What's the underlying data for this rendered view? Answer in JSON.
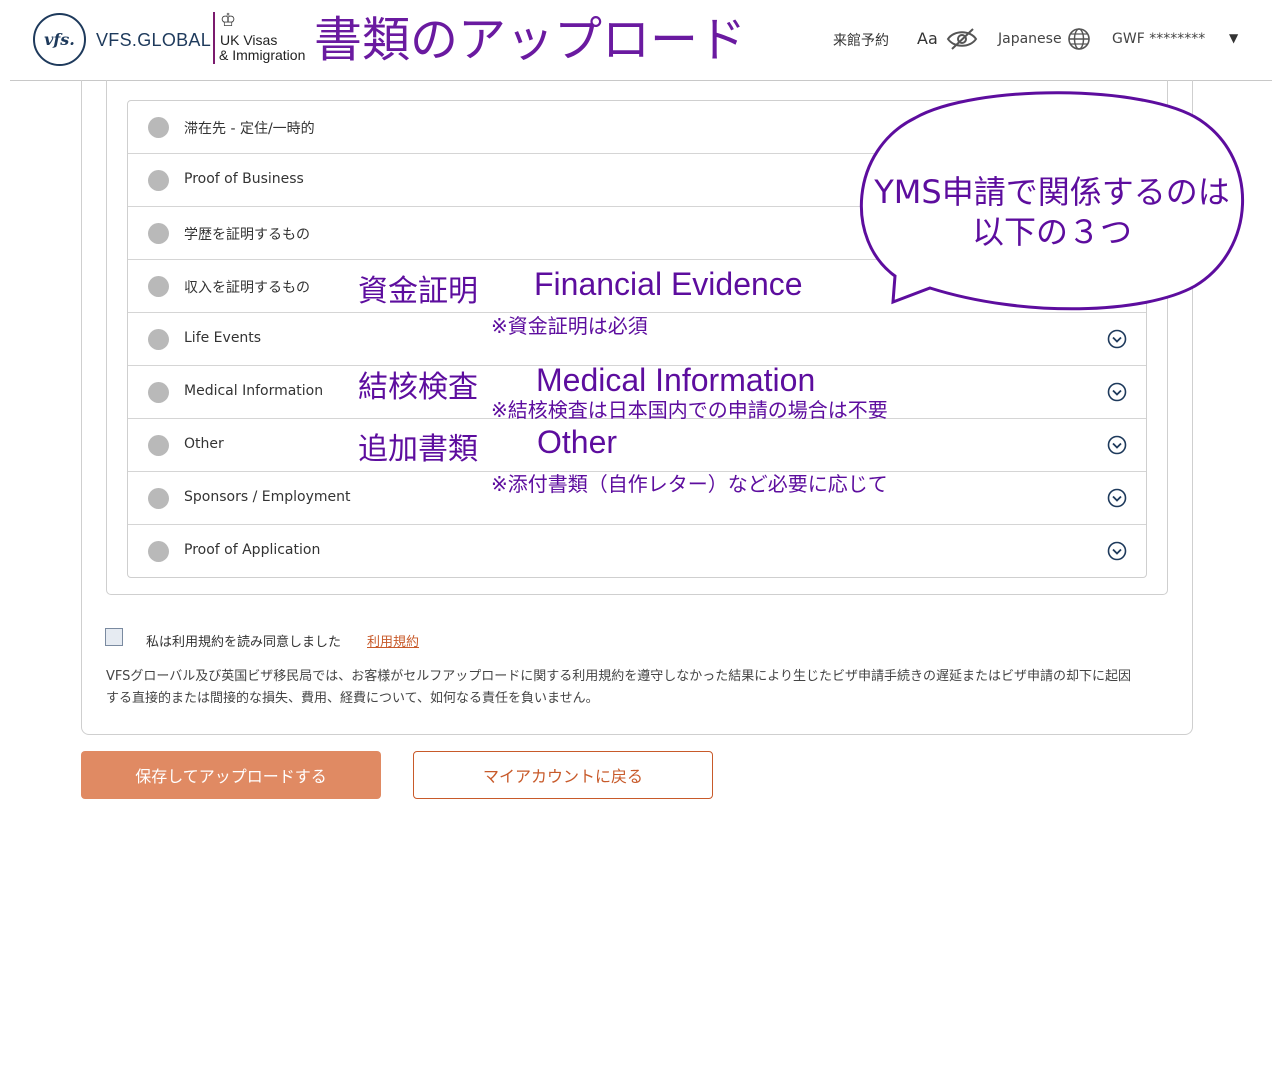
{
  "header": {
    "vfs_logo_text": "vfs.",
    "vfs_brand": "VFS.GLOBAL",
    "ukvi_line1": "UK Visas",
    "ukvi_line2": "& Immigration",
    "overlay_title": "書類のアップロード",
    "nav_appointment": "来館予約",
    "nav_font_size": "Aa",
    "nav_language": "Japanese",
    "nav_user": "GWF ********",
    "nav_caret": "▼",
    "icons": [
      "eye-slash-icon",
      "globe-icon",
      "caret-down-icon"
    ]
  },
  "documents": [
    {
      "label": "滞在先 - 定住/一時的",
      "has_chevron": false
    },
    {
      "label": "Proof of Business",
      "has_chevron": false
    },
    {
      "label": "学歴を証明するもの",
      "has_chevron": false
    },
    {
      "label": "収入を証明するもの",
      "has_chevron": false
    },
    {
      "label": "Life Events",
      "has_chevron": true
    },
    {
      "label": "Medical Information",
      "has_chevron": true
    },
    {
      "label": "Other",
      "has_chevron": true
    },
    {
      "label": "Sponsors / Employment",
      "has_chevron": true
    },
    {
      "label": "Proof of Application",
      "has_chevron": true
    }
  ],
  "annotations": {
    "bubble": [
      "YMS申請で関係するのは",
      "以下の３つ"
    ],
    "financial_jp": "資金証明",
    "financial_en": "Financial Evidence",
    "financial_note": "※資金証明は必須",
    "medical_jp": "結核検査",
    "medical_en": "Medical Information",
    "medical_note": "※結核検査は日本国内での申請の場合は不要",
    "other_jp": "追加書類",
    "other_en": "Other",
    "other_note": "※添付書類（自作レター）など必要に応じて",
    "color": "#5d0d9e"
  },
  "terms": {
    "label": "私は利用規約を読み同意しました",
    "link": "利用規約",
    "disclaimer": "VFSグローバル及び英国ビザ移民局では、お客様がセルフアップロードに関する利用規約を遵守しなかった結果により生じたビザ申請手続きの遅延またはビザ申請の却下に起因する直接的または間接的な損失、費用、経費について、如何なる責任を負いません。"
  },
  "buttons": {
    "save": "保存してアップロードする",
    "back": "マイアカウントに戻る"
  },
  "colors": {
    "primary_button": "#e08a63",
    "link": "#c85a2a",
    "brand_navy": "#1e3a5c"
  }
}
